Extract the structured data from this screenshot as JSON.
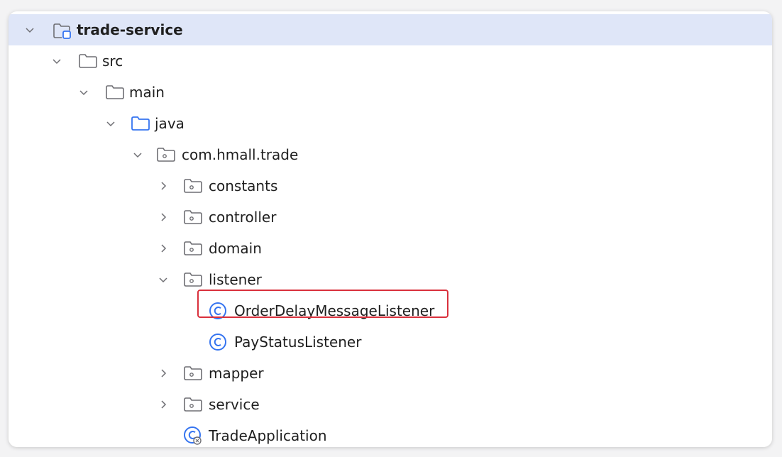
{
  "tree": {
    "root": {
      "label": "trade-service"
    },
    "src": {
      "label": "src"
    },
    "main": {
      "label": "main"
    },
    "java": {
      "label": "java"
    },
    "package": {
      "label": "com.hmall.trade"
    },
    "constants": {
      "label": "constants"
    },
    "controller": {
      "label": "controller"
    },
    "domain": {
      "label": "domain"
    },
    "listener": {
      "label": "listener"
    },
    "order_delay": {
      "label": "OrderDelayMessageListener"
    },
    "pay_status": {
      "label": "PayStatusListener"
    },
    "mapper": {
      "label": "mapper"
    },
    "service": {
      "label": "service"
    },
    "trade_app": {
      "label": "TradeApplication"
    }
  },
  "icons": {
    "module": "module-folder-icon",
    "folder": "folder-icon",
    "source_folder": "source-folder-icon",
    "package": "package-icon",
    "class": "class-icon",
    "app_class": "application-class-icon",
    "expanded": "chevron-down-icon",
    "collapsed": "chevron-right-icon"
  },
  "colors": {
    "selection": "#dfe6f8",
    "highlight": "#d9303c",
    "class_icon": "#3574f0",
    "source_folder": "#3574f0"
  }
}
